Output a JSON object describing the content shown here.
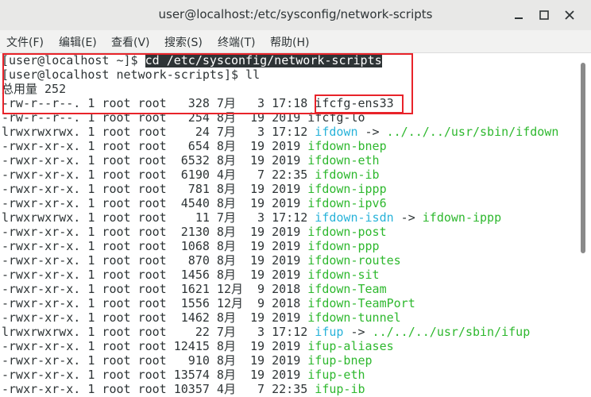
{
  "window": {
    "title": "user@localhost:/etc/sysconfig/network-scripts"
  },
  "menu": [
    {
      "id": "file",
      "label": "文件(F)"
    },
    {
      "id": "edit",
      "label": "编辑(E)"
    },
    {
      "id": "view",
      "label": "查看(V)"
    },
    {
      "id": "search",
      "label": "搜索(S)"
    },
    {
      "id": "terminal",
      "label": "终端(T)"
    },
    {
      "id": "help",
      "label": "帮助(H)"
    }
  ],
  "terminal": {
    "prompt1": "[user@localhost ~]$ ",
    "command1": "cd /etc/sysconfig/network-scripts",
    "prompt2": "[user@localhost network-scripts]$ ",
    "command2": "ll",
    "total": "总用量 252",
    "rows": [
      {
        "info": "-rw-r--r--. 1 root root   328 7月   3 17:18 ",
        "name": "ifcfg-ens33",
        "color": "default",
        "target": ""
      },
      {
        "info": "-rw-r--r--. 1 root root   254 8月  19 2019 ",
        "name": "ifcfg-lo",
        "color": "default",
        "target": ""
      },
      {
        "info": "lrwxrwxrwx. 1 root root    24 7月   3 17:12 ",
        "name": "ifdown",
        "color": "cyan",
        "target": "../../../usr/sbin/ifdown"
      },
      {
        "info": "-rwxr-xr-x. 1 root root   654 8月  19 2019 ",
        "name": "ifdown-bnep",
        "color": "green",
        "target": ""
      },
      {
        "info": "-rwxr-xr-x. 1 root root  6532 8月  19 2019 ",
        "name": "ifdown-eth",
        "color": "green",
        "target": ""
      },
      {
        "info": "-rwxr-xr-x. 1 root root  6190 4月   7 22:35 ",
        "name": "ifdown-ib",
        "color": "green",
        "target": ""
      },
      {
        "info": "-rwxr-xr-x. 1 root root   781 8月  19 2019 ",
        "name": "ifdown-ippp",
        "color": "green",
        "target": ""
      },
      {
        "info": "-rwxr-xr-x. 1 root root  4540 8月  19 2019 ",
        "name": "ifdown-ipv6",
        "color": "green",
        "target": ""
      },
      {
        "info": "lrwxrwxrwx. 1 root root    11 7月   3 17:12 ",
        "name": "ifdown-isdn",
        "color": "cyan",
        "target": "ifdown-ippp"
      },
      {
        "info": "-rwxr-xr-x. 1 root root  2130 8月  19 2019 ",
        "name": "ifdown-post",
        "color": "green",
        "target": ""
      },
      {
        "info": "-rwxr-xr-x. 1 root root  1068 8月  19 2019 ",
        "name": "ifdown-ppp",
        "color": "green",
        "target": ""
      },
      {
        "info": "-rwxr-xr-x. 1 root root   870 8月  19 2019 ",
        "name": "ifdown-routes",
        "color": "green",
        "target": ""
      },
      {
        "info": "-rwxr-xr-x. 1 root root  1456 8月  19 2019 ",
        "name": "ifdown-sit",
        "color": "green",
        "target": ""
      },
      {
        "info": "-rwxr-xr-x. 1 root root  1621 12月  9 2018 ",
        "name": "ifdown-Team",
        "color": "green",
        "target": ""
      },
      {
        "info": "-rwxr-xr-x. 1 root root  1556 12月  9 2018 ",
        "name": "ifdown-TeamPort",
        "color": "green",
        "target": ""
      },
      {
        "info": "-rwxr-xr-x. 1 root root  1462 8月  19 2019 ",
        "name": "ifdown-tunnel",
        "color": "green",
        "target": ""
      },
      {
        "info": "lrwxrwxrwx. 1 root root    22 7月   3 17:12 ",
        "name": "ifup",
        "color": "cyan",
        "target": "../../../usr/sbin/ifup"
      },
      {
        "info": "-rwxr-xr-x. 1 root root 12415 8月  19 2019 ",
        "name": "ifup-aliases",
        "color": "green",
        "target": ""
      },
      {
        "info": "-rwxr-xr-x. 1 root root   910 8月  19 2019 ",
        "name": "ifup-bnep",
        "color": "green",
        "target": ""
      },
      {
        "info": "-rwxr-xr-x. 1 root root 13574 8月  19 2019 ",
        "name": "ifup-eth",
        "color": "green",
        "target": ""
      },
      {
        "info": "-rwxr-xr-x. 1 root root 10357 4月   7 22:35 ",
        "name": "ifup-ib",
        "color": "green",
        "target": ""
      }
    ]
  },
  "colors": {
    "executable": "#2eb82e",
    "symlink": "#28b3d9",
    "highlight_box": "#e8232a",
    "selection": "#2e3436"
  }
}
